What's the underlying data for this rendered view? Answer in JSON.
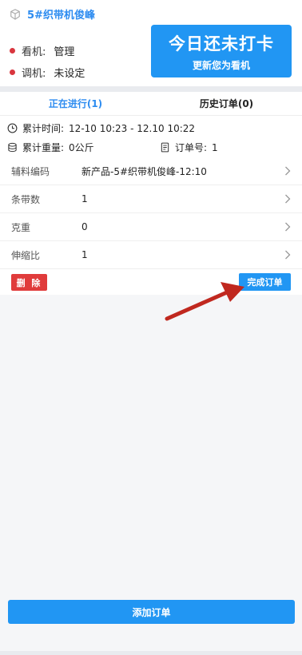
{
  "header": {
    "machine_name": "5#织带机俊峰",
    "watch_label": "看机:",
    "watch_value": "管理",
    "adjust_label": "调机:",
    "adjust_value": "未设定",
    "checkin_title": "今日还未打卡",
    "checkin_subtitle": "更新您为看机"
  },
  "tabs": [
    {
      "label": "正在进行(1)",
      "active": true
    },
    {
      "label": "历史订单(0)",
      "active": false
    }
  ],
  "summary": {
    "time_label": "累计时间:",
    "time_value": "12-10 10:23 - 12.10 10:22",
    "weight_label": "累计重量:",
    "weight_value": "0公斤",
    "order_label": "订单号:",
    "order_value": "1"
  },
  "fields": [
    {
      "label": "辅料编码",
      "value": "新产品-5#织带机俊峰-12:10"
    },
    {
      "label": "条带数",
      "value": "1"
    },
    {
      "label": "克重",
      "value": "0"
    },
    {
      "label": "伸缩比",
      "value": "1"
    }
  ],
  "actions": {
    "delete_label": "删 除",
    "complete_label": "完成订单",
    "add_order_label": "添加订单"
  },
  "colors": {
    "primary": "#2196f3",
    "danger": "#e03b3b",
    "annotation_arrow": "#c0281f"
  }
}
